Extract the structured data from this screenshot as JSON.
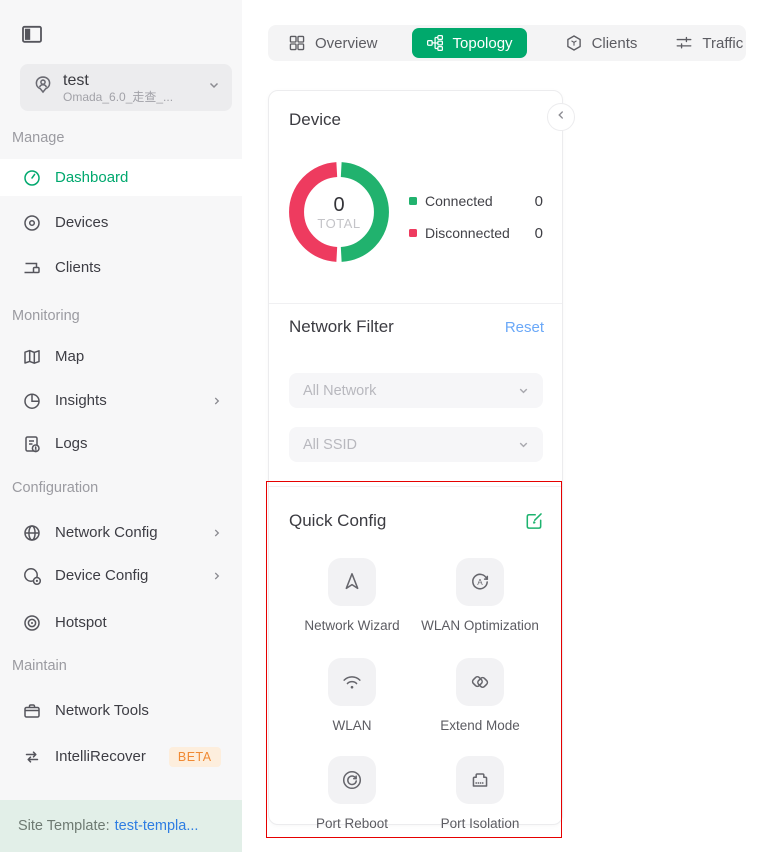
{
  "colors": {
    "accent_green": "#00a96c",
    "donut_green": "#21b26e",
    "donut_red": "#ee3b5f",
    "highlight_red": "#e60000",
    "reset_blue": "#6aa8f8",
    "link_blue": "#2e7de2",
    "beta_orange": "#f08a34"
  },
  "sidebar": {
    "site": {
      "name": "test",
      "subtitle": "Omada_6.0_走查_..."
    },
    "sections": {
      "manage": "Manage",
      "monitoring": "Monitoring",
      "configuration": "Configuration",
      "maintain": "Maintain"
    },
    "items": {
      "dashboard": "Dashboard",
      "devices": "Devices",
      "clients": "Clients",
      "map": "Map",
      "insights": "Insights",
      "logs": "Logs",
      "network_config": "Network Config",
      "device_config": "Device Config",
      "hotspot": "Hotspot",
      "network_tools": "Network Tools",
      "intellirecover": "IntelliRecover",
      "intellirecover_badge": "BETA"
    },
    "footer": {
      "label": "Site Template:",
      "link": "test-templa..."
    }
  },
  "tabs": {
    "overview": "Overview",
    "topology": "Topology",
    "clients": "Clients",
    "traffic": "Traffic",
    "active": "Topology"
  },
  "device": {
    "title": "Device",
    "total": "0",
    "total_label": "TOTAL",
    "legend": [
      {
        "label": "Connected",
        "value": "0",
        "color": "#21b26e"
      },
      {
        "label": "Disconnected",
        "value": "0",
        "color": "#ee3b5f"
      }
    ]
  },
  "chart_data": {
    "type": "pie",
    "title": "Device",
    "categories": [
      "Connected",
      "Disconnected"
    ],
    "values": [
      0,
      0
    ],
    "center_label": "0 TOTAL",
    "colors": [
      "#21b26e",
      "#ee3b5f"
    ],
    "legend_position": "right"
  },
  "network_filter": {
    "title": "Network Filter",
    "reset": "Reset",
    "network_dropdown": "All Network",
    "ssid_dropdown": "All SSID"
  },
  "quick_config": {
    "title": "Quick Config",
    "items": [
      "Network Wizard",
      "WLAN Optimization",
      "WLAN",
      "Extend Mode",
      "Port Reboot",
      "Port Isolation"
    ]
  }
}
